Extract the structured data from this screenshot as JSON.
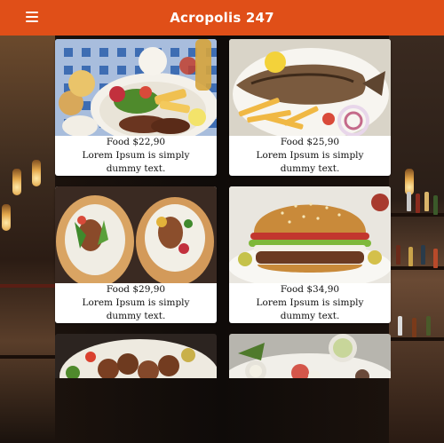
{
  "header": {
    "title": "Acropolis 247",
    "menu_icon": "hamburger-menu-icon",
    "background_color": "#e04f18"
  },
  "cards": [
    {
      "price": "Food $22,90",
      "description": "Lorem Ipsum is simply dummy text.",
      "photo": "steak-platter-photo"
    },
    {
      "price": "Food $25,90",
      "description": "Lorem Ipsum is simply dummy text.",
      "photo": "grilled-fish-fries-photo"
    },
    {
      "price": "Food $29,90",
      "description": "Lorem Ipsum is simply dummy text.",
      "photo": "gyros-wrap-photo"
    },
    {
      "price": "Food $34,90",
      "description": "Lorem Ipsum is simply dummy text.",
      "photo": "burger-photo"
    }
  ],
  "partial_cards": [
    {
      "photo": "meatballs-plate-photo"
    },
    {
      "photo": "dips-platter-photo"
    }
  ]
}
